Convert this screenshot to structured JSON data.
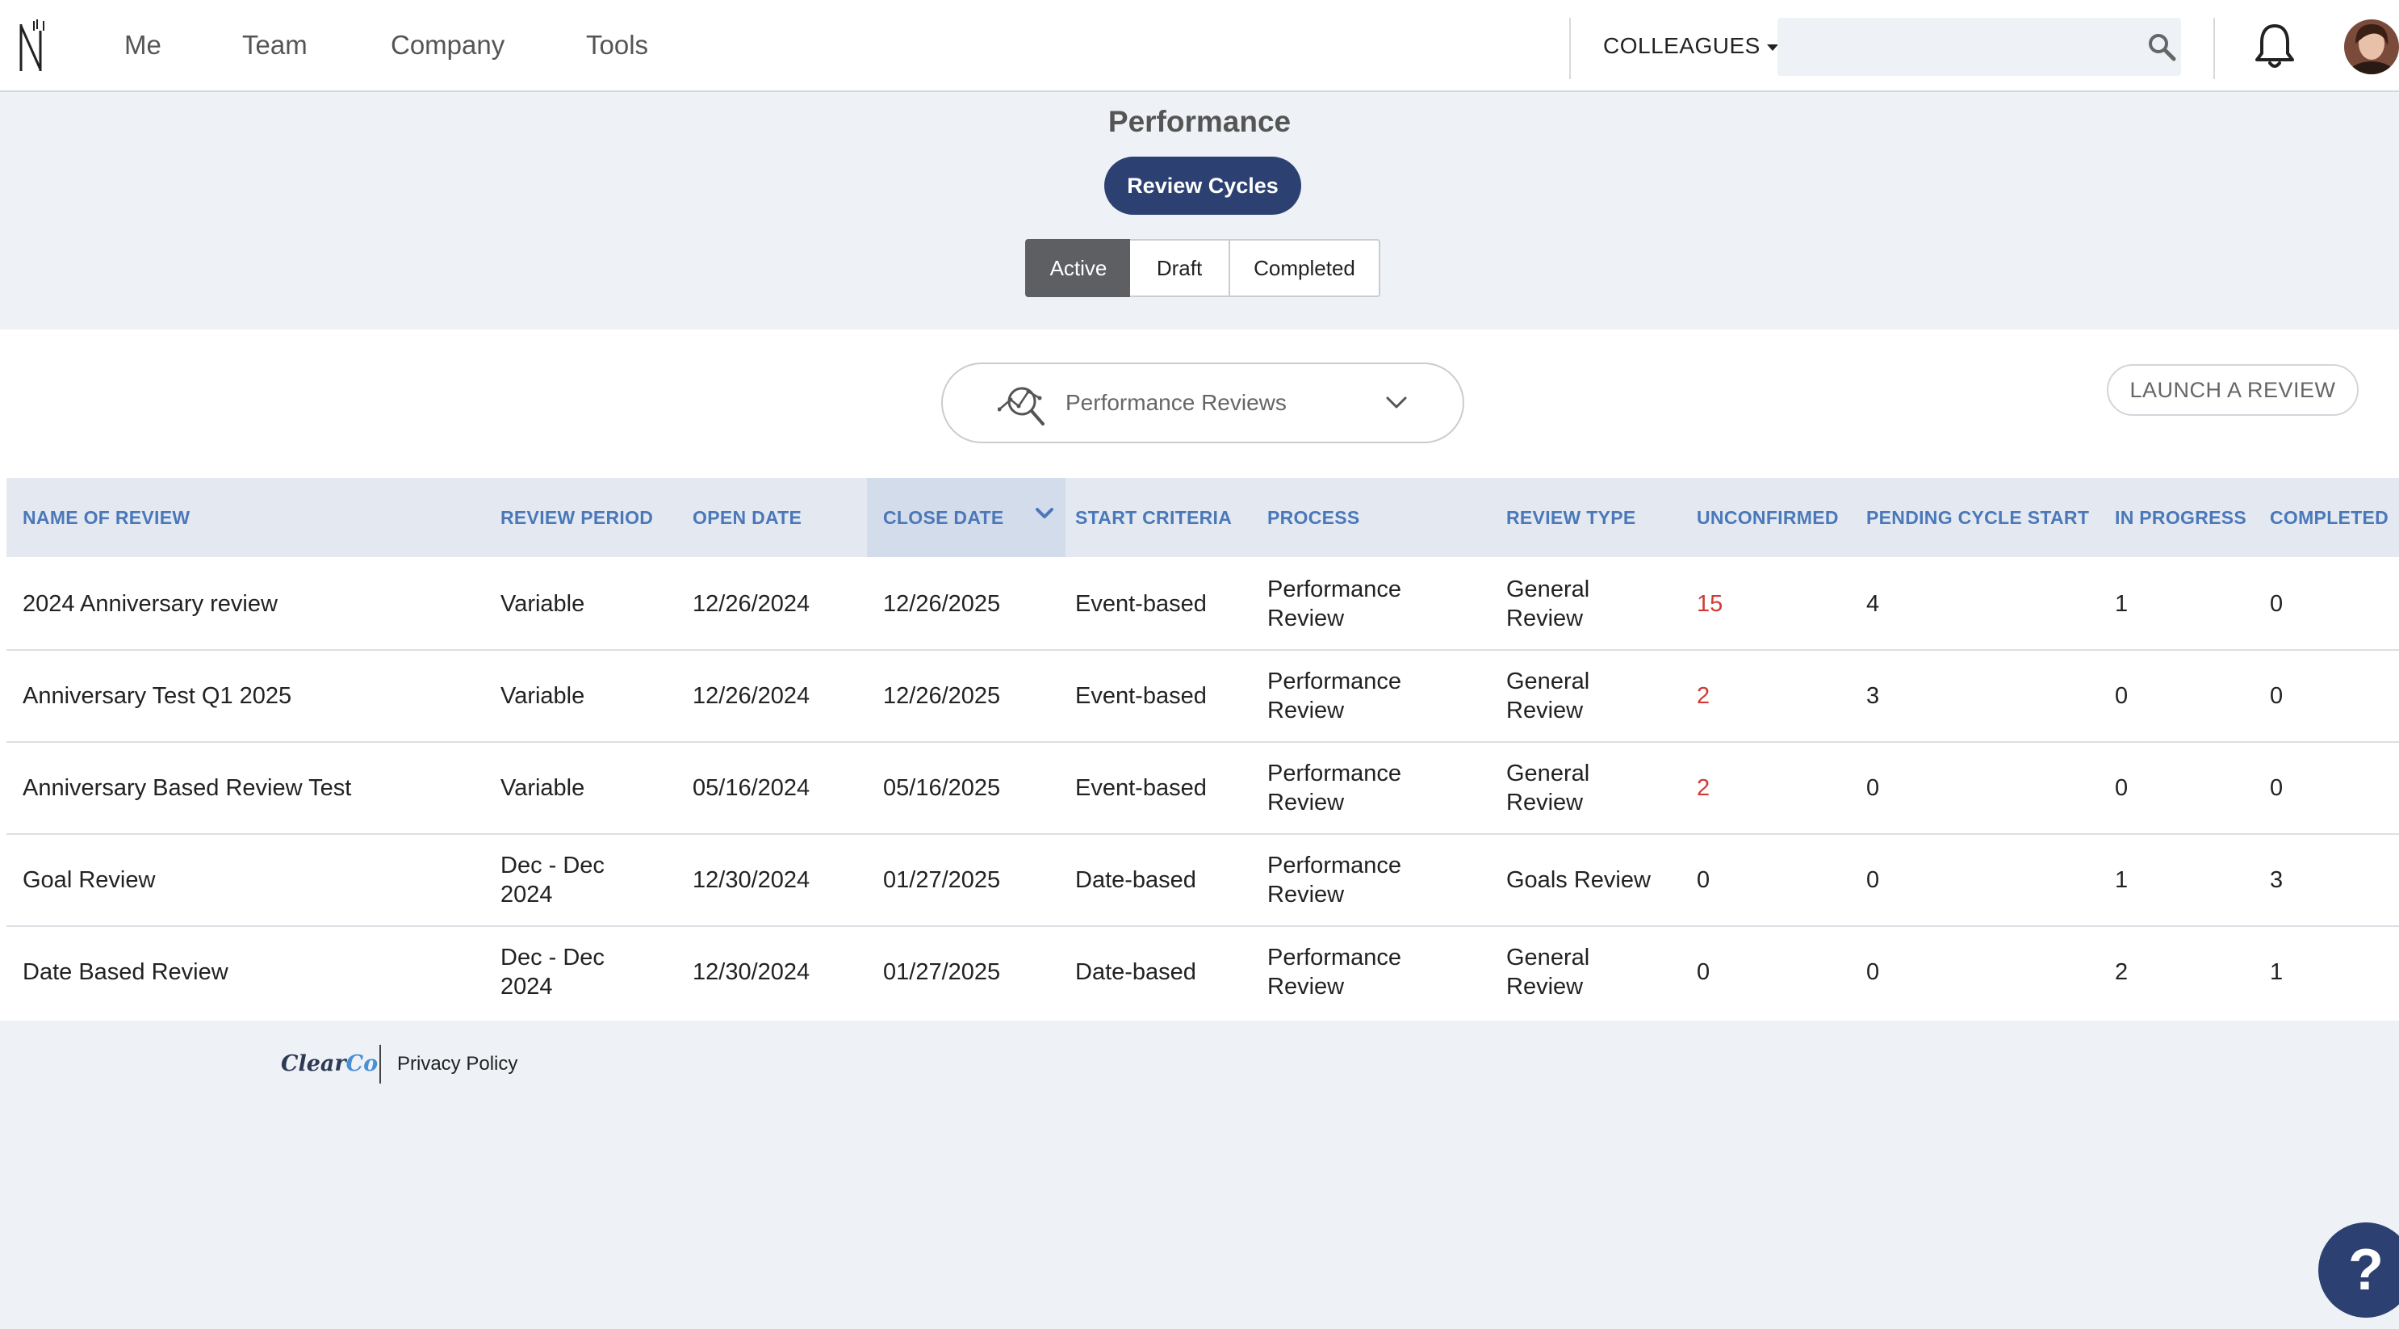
{
  "nav": {
    "items": [
      "Me",
      "Team",
      "Company",
      "Tools"
    ],
    "colleagues_label": "COLLEAGUES",
    "search_value": ""
  },
  "header": {
    "title": "Performance",
    "review_cycles_label": "Review Cycles",
    "segments": [
      "Active",
      "Draft",
      "Completed"
    ],
    "active_segment": "Active"
  },
  "toolbar": {
    "dropdown_label": "Performance Reviews",
    "launch_label": "LAUNCH A REVIEW"
  },
  "table": {
    "columns": [
      "NAME OF REVIEW",
      "REVIEW PERIOD",
      "OPEN DATE",
      "CLOSE DATE",
      "START CRITERIA",
      "PROCESS",
      "REVIEW TYPE",
      "UNCONFIRMED",
      "PENDING CYCLE START",
      "IN PROGRESS",
      "COMPLETED"
    ],
    "sorted_column": "CLOSE DATE",
    "rows": [
      {
        "name": "2024 Anniversary review",
        "period": [
          "Variable"
        ],
        "open": "12/26/2024",
        "close": "12/26/2025",
        "criteria": "Event-based",
        "process": [
          "Performance",
          "Review"
        ],
        "type": [
          "General",
          "Review"
        ],
        "unconfirmed": "15",
        "pending": "4",
        "in_progress": "1",
        "completed": "0"
      },
      {
        "name": "Anniversary Test Q1 2025",
        "period": [
          "Variable"
        ],
        "open": "12/26/2024",
        "close": "12/26/2025",
        "criteria": "Event-based",
        "process": [
          "Performance",
          "Review"
        ],
        "type": [
          "General",
          "Review"
        ],
        "unconfirmed": "2",
        "pending": "3",
        "in_progress": "0",
        "completed": "0"
      },
      {
        "name": "Anniversary Based Review Test",
        "period": [
          "Variable"
        ],
        "open": "05/16/2024",
        "close": "05/16/2025",
        "criteria": "Event-based",
        "process": [
          "Performance",
          "Review"
        ],
        "type": [
          "General",
          "Review"
        ],
        "unconfirmed": "2",
        "pending": "0",
        "in_progress": "0",
        "completed": "0"
      },
      {
        "name": "Goal Review",
        "period": [
          "Dec - Dec",
          "2024"
        ],
        "open": "12/30/2024",
        "close": "01/27/2025",
        "criteria": "Date-based",
        "process": [
          "Performance",
          "Review"
        ],
        "type": [
          "Goals Review"
        ],
        "unconfirmed": "0",
        "pending": "0",
        "in_progress": "1",
        "completed": "3"
      },
      {
        "name": "Date Based Review",
        "period": [
          "Dec - Dec",
          "2024"
        ],
        "open": "12/30/2024",
        "close": "01/27/2025",
        "criteria": "Date-based",
        "process": [
          "Performance",
          "Review"
        ],
        "type": [
          "General",
          "Review"
        ],
        "unconfirmed": "0",
        "pending": "0",
        "in_progress": "2",
        "completed": "1"
      }
    ]
  },
  "footer": {
    "logo_main": "Clear",
    "logo_accent": "Co",
    "privacy_label": "Privacy Policy"
  },
  "help": {
    "label": "?"
  },
  "colors": {
    "primary": "#2c4172",
    "header_text": "#4a78b8",
    "alert": "#d13a35"
  },
  "icons": [
    "logo-icon",
    "search-icon",
    "bell-icon",
    "avatar",
    "performance-reviews-icon",
    "chevron-down-icon",
    "sort-chevron-icon",
    "help-icon"
  ]
}
